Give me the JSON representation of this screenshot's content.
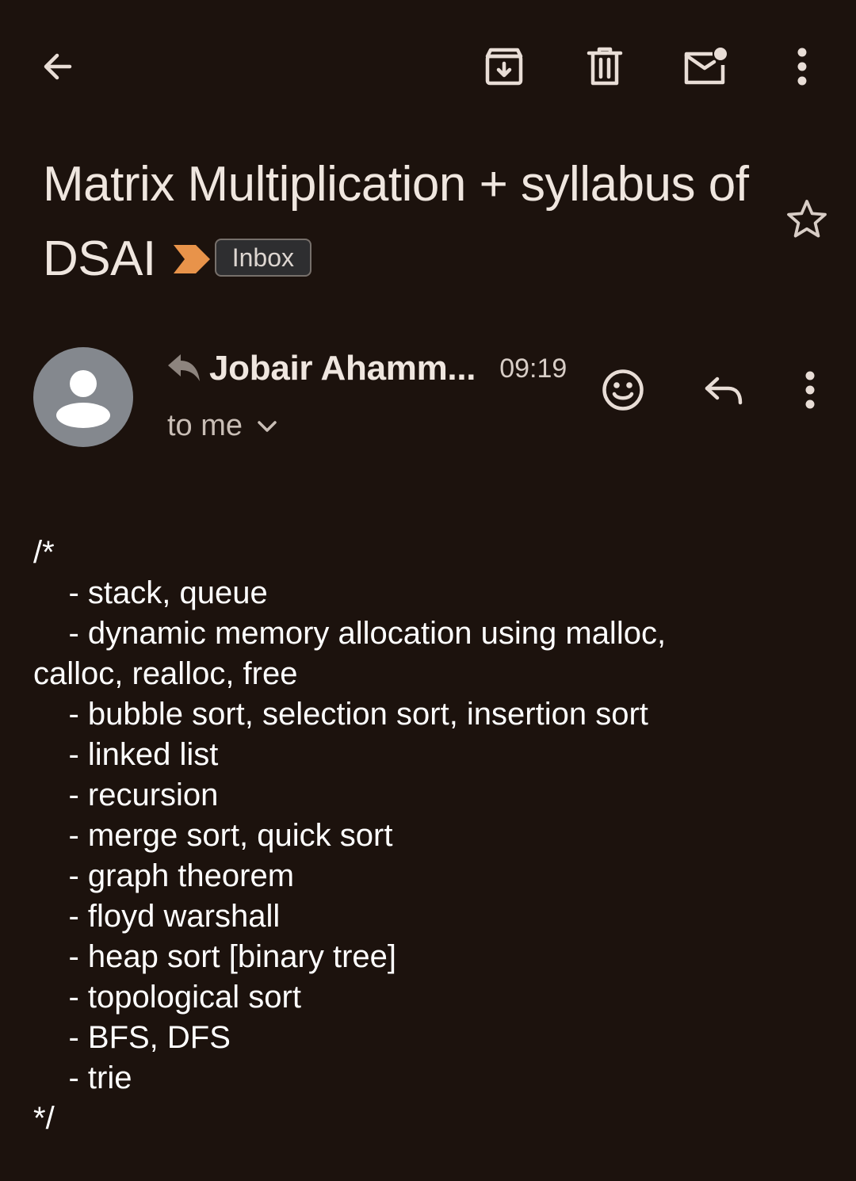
{
  "toolbar": {
    "back_icon": "arrow-left-icon",
    "archive_icon": "archive-icon",
    "delete_icon": "trash-icon",
    "mark_unread_icon": "mail-unread-icon",
    "more_icon": "more-vert-icon"
  },
  "email": {
    "subject": "Matrix Multiplication + syllabus of DSAI",
    "label": "Inbox",
    "important_marker_color": "#e8934a",
    "starred": false,
    "sender_name": "Jobair Ahamm...",
    "time": "09:19",
    "recipient": "to me",
    "replied": true,
    "body": "/*\n    - stack, queue\n    - dynamic memory allocation using malloc,\ncalloc, realloc, free\n    - bubble sort, selection sort, insertion sort\n    - linked list\n    - recursion\n    - merge sort, quick sort\n    - graph theorem\n    - floyd warshall\n    - heap sort [binary tree]\n    - topological sort\n    - BFS, DFS\n    - trie\n*/"
  },
  "colors": {
    "background": "#1c120d",
    "text": "#efe6df",
    "chip_background": "#2e2e30",
    "avatar": "#84888e"
  }
}
